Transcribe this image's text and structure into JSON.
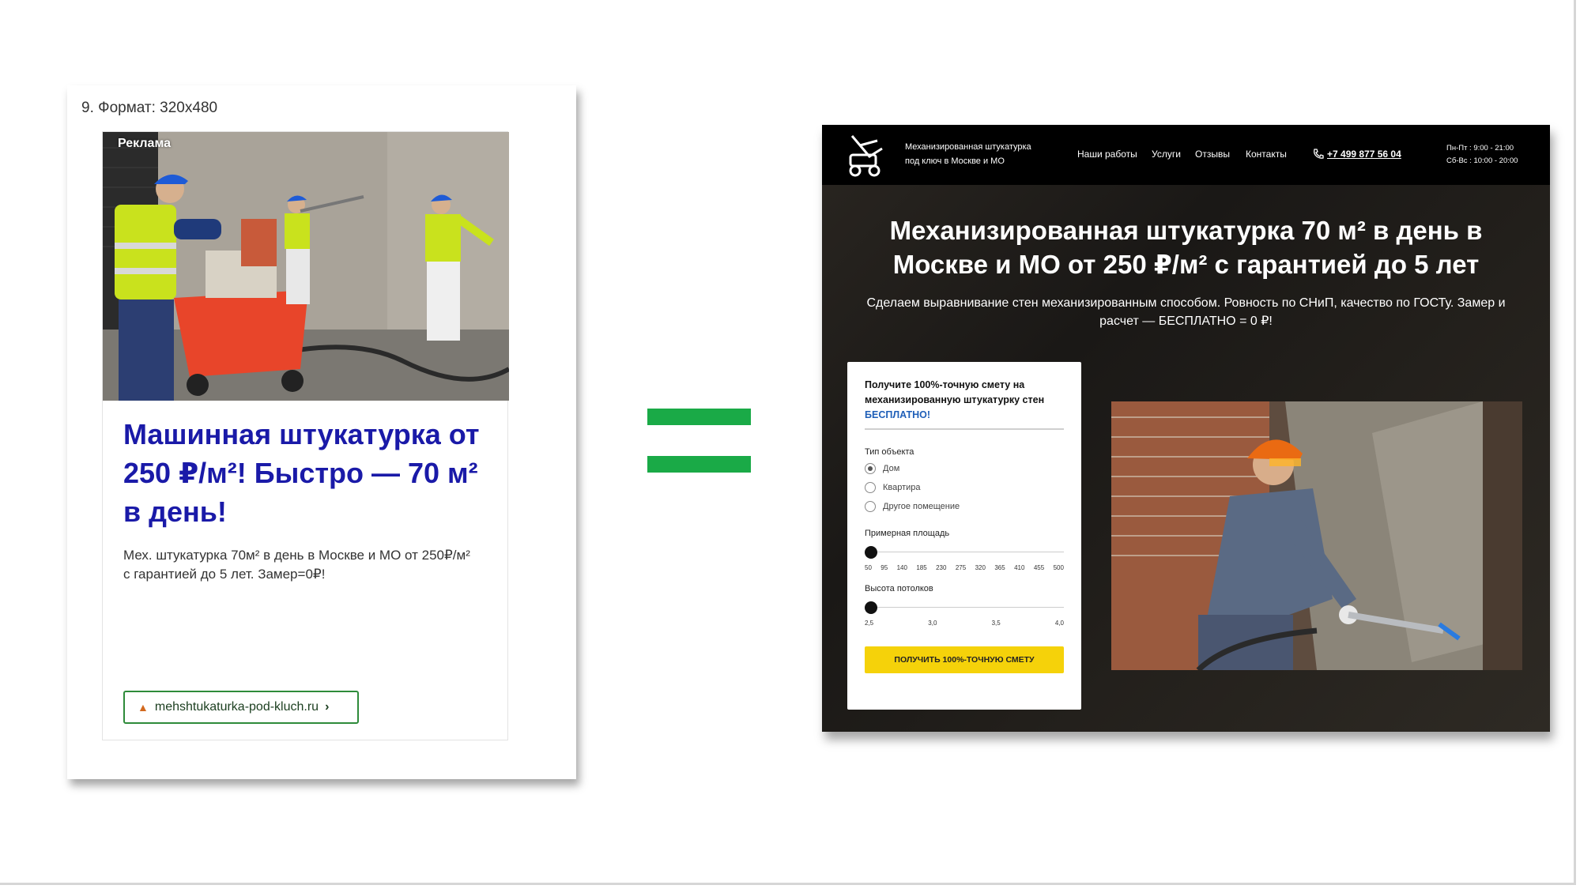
{
  "ad": {
    "format_label": "9. Формат: 320х480",
    "badge": "Реклама",
    "title": "Машинная штукатурка от 250 ₽/м²! Быстро — 70 м² в день!",
    "description": "Мех. штукатурка 70м² в день в Москве и МО от 250₽/м² с гарантией до 5 лет. Замер=0₽!",
    "link_text": "mehshtukaturka-pod-kluch.ru",
    "link_chevron": "›"
  },
  "colors": {
    "ad_title": "#1a1aa8",
    "link_border": "#2e8b3a",
    "equals": "#1aaa47",
    "cta": "#f5d20a",
    "free_text": "#1f5fb8"
  },
  "landing": {
    "brand_line1": "Механизированная штукатурка",
    "brand_line2": "под ключ в Москве и МО",
    "nav": [
      "Наши работы",
      "Услуги",
      "Отзывы",
      "Контакты"
    ],
    "phone": "+7 499 877 56 04",
    "hours_line1": "Пн-Пт : 9:00 - 21:00",
    "hours_line2": "Сб-Вс : 10:00 - 20:00",
    "headline": "Механизированная штукатурка 70 м² в день в Москве и МО от 250 ₽/м² с гарантией до 5 лет",
    "subheadline": "Сделаем выравнивание стен механизированным способом. Ровность по СНиП, качество по ГОСТу. Замер и расчет — БЕСПЛАТНО = 0 ₽!",
    "form": {
      "title_main": "Получите 100%-точную смету на механизированную штукатурку стен ",
      "title_free": "БЕСПЛАТНО!",
      "object_label": "Тип объекта",
      "options": [
        "Дом",
        "Квартира",
        "Другое помещение"
      ],
      "selected_option": "Дом",
      "area_label": "Примерная площадь",
      "area_ticks": [
        "50",
        "95",
        "140",
        "185",
        "230",
        "275",
        "320",
        "365",
        "410",
        "455",
        "500"
      ],
      "area_value": 50,
      "height_label": "Высота потолков",
      "height_ticks": [
        "2,5",
        "3,0",
        "3,5",
        "4,0"
      ],
      "height_value": 2.5,
      "cta": "ПОЛУЧИТЬ 100%-ТОЧНУЮ СМЕТУ"
    }
  },
  "icons": [
    "logo-plastering-machine-icon",
    "phone-icon",
    "fire-icon",
    "chevron-right-icon"
  ]
}
